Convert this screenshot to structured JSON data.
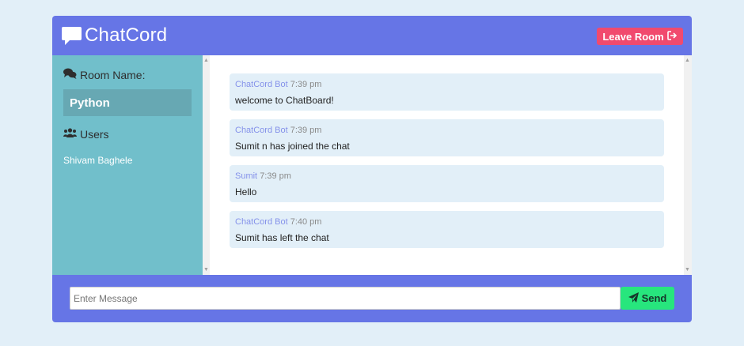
{
  "app": {
    "title": "ChatCord",
    "leave_label": "Leave Room",
    "colors": {
      "header": "#6675e6",
      "sidebar": "#71bfcb",
      "leave": "#f14a6e",
      "send": "#27e67d",
      "message_bg": "#e2eff8"
    }
  },
  "sidebar": {
    "room_heading": "Room Name:",
    "room_name": "Python",
    "users_heading": "Users",
    "users": [
      "Shivam Baghele"
    ]
  },
  "messages": [
    {
      "user": "ChatCord Bot",
      "time": "7:39 pm",
      "text": "welcome to ChatBoard!"
    },
    {
      "user": "ChatCord Bot",
      "time": "7:39 pm",
      "text": "Sumit n has joined the chat"
    },
    {
      "user": "Sumit",
      "time": "7:39 pm",
      "text": "Hello"
    },
    {
      "user": "ChatCord Bot",
      "time": "7:40 pm",
      "text": "Sumit has left the chat"
    }
  ],
  "composer": {
    "placeholder": "Enter Message",
    "value": "",
    "send_label": "Send"
  },
  "icons": {
    "logo": "chat-bubble-icon",
    "leave": "sign-out-icon",
    "room": "comments-icon",
    "users": "users-icon",
    "send": "paper-plane-icon"
  }
}
